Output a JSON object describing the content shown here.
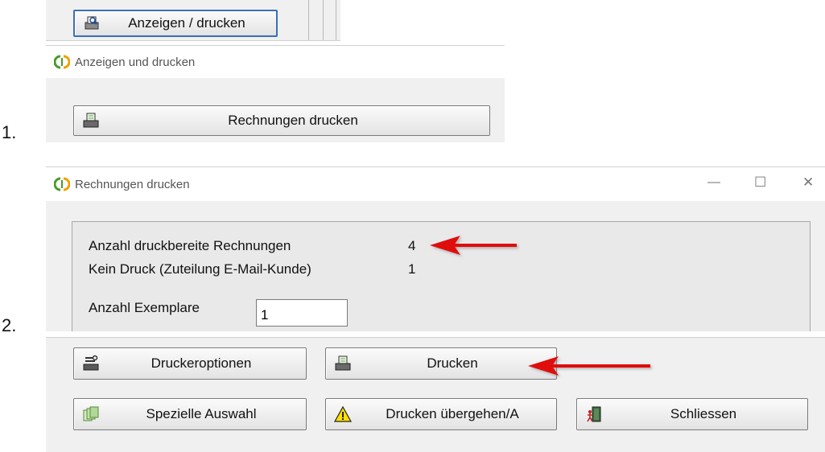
{
  "step1": {
    "number": "1.",
    "top_button_label": "Anzeigen / drucken",
    "window_title": "Anzeigen und drucken",
    "print_invoices_button_label": "Rechnungen drucken"
  },
  "step2": {
    "number": "2.",
    "window_title": "Rechnungen drucken",
    "window_controls": {
      "minimize": "—",
      "maximize": "☐",
      "close": "✕"
    },
    "rows": [
      {
        "label": "Anzahl druckbereite Rechnungen",
        "value": "4"
      },
      {
        "label": "Kein Druck (Zuteilung E-Mail-Kunde)",
        "value": "1"
      }
    ],
    "copies": {
      "label": "Anzahl Exemplare",
      "value": "1"
    },
    "buttons": {
      "printer_options": "Druckeroptionen",
      "print": "Drucken",
      "special_selection": "Spezielle Auswahl",
      "skip_print": "Drucken übergehen/A",
      "close": "Schliessen"
    }
  },
  "colors": {
    "arrow": "#e01010",
    "panel": "#ebebeb",
    "frame": "#c8c8c8"
  },
  "icons": [
    "printer-preview-icon",
    "app-logo-icon",
    "printer-icon",
    "wrench-printer-icon",
    "documents-icon",
    "warning-icon",
    "exit-door-icon",
    "red-arrow"
  ]
}
